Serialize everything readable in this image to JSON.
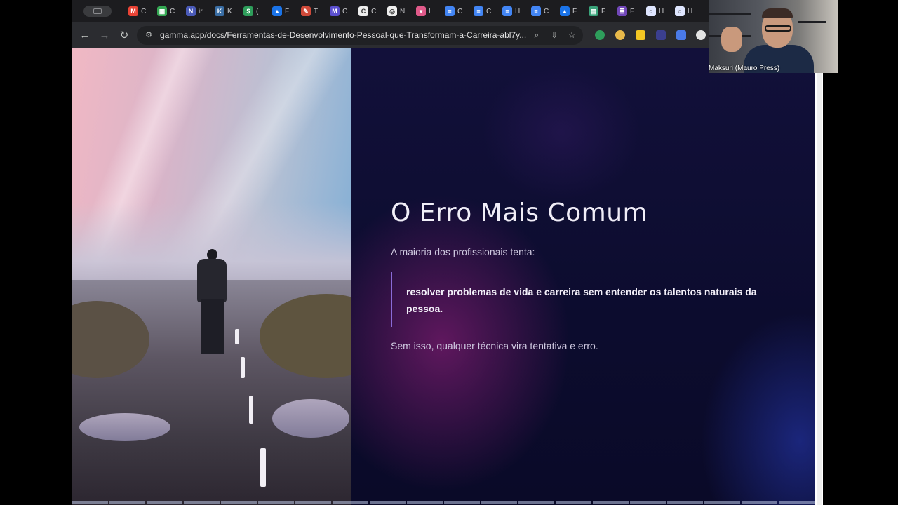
{
  "browser": {
    "tabs": [
      {
        "icon": "gmail-icon",
        "color": "#ea4335",
        "glyph": "M",
        "label": "C"
      },
      {
        "icon": "sheets-icon",
        "color": "#34a853",
        "glyph": "▦",
        "label": "C"
      },
      {
        "icon": "n8n-icon",
        "color": "#4a5ab8",
        "glyph": "N",
        "label": "ir"
      },
      {
        "icon": "k-icon",
        "color": "#3a6ea5",
        "glyph": "K",
        "label": "K"
      },
      {
        "icon": "dollar-icon",
        "color": "#2e9e5b",
        "glyph": "$",
        "label": "("
      },
      {
        "icon": "drive-icon",
        "color": "#1a73e8",
        "glyph": "▲",
        "label": "F"
      },
      {
        "icon": "app-icon",
        "color": "#d04a3a",
        "glyph": "✎",
        "label": "T"
      },
      {
        "icon": "m-icon",
        "color": "#5b4fcf",
        "glyph": "M",
        "label": "C"
      },
      {
        "icon": "c-icon",
        "color": "#eeeeee",
        "glyph": "C",
        "label": "C"
      },
      {
        "icon": "openai-icon",
        "color": "#eeeeee",
        "glyph": "◎",
        "label": "N"
      },
      {
        "icon": "heart-icon",
        "color": "#e05a8a",
        "glyph": "♥",
        "label": "L"
      },
      {
        "icon": "docs-icon",
        "color": "#4285f4",
        "glyph": "≡",
        "label": "C"
      },
      {
        "icon": "docs-icon",
        "color": "#4285f4",
        "glyph": "≡",
        "label": "C"
      },
      {
        "icon": "docs-icon",
        "color": "#4285f4",
        "glyph": "≡",
        "label": "H"
      },
      {
        "icon": "docs-icon",
        "color": "#4285f4",
        "glyph": "≡",
        "label": "C"
      },
      {
        "icon": "drive-icon",
        "color": "#1a73e8",
        "glyph": "▲",
        "label": "F"
      },
      {
        "icon": "calendar-icon",
        "color": "#3aa37a",
        "glyph": "▤",
        "label": "F"
      },
      {
        "icon": "forms-icon",
        "color": "#7248b9",
        "glyph": "≣",
        "label": "F"
      },
      {
        "icon": "globe-icon",
        "color": "#dfe6ff",
        "glyph": "○",
        "label": "H"
      },
      {
        "icon": "globe-icon",
        "color": "#dfe6ff",
        "glyph": "○",
        "label": "H"
      }
    ],
    "url": "gamma.app/docs/Ferramentas-de-Desenvolvimento-Pessoal-que-Transformam-a-Carreira-abl7y..."
  },
  "slide": {
    "title": "O Erro Mais Comum",
    "intro": "A maioria dos profissionais tenta:",
    "quote": "resolver problemas de vida e carreira sem entender os talentos naturais da pessoa.",
    "outro": "Sem isso, qualquer técnica vira tentativa e erro."
  },
  "video_call": {
    "participant_name": "Maksuri (Mauro Press)"
  },
  "colors": {
    "slide_bg": "#0c0c2e",
    "quote_bar": "#8a6bd6",
    "title": "#f1eef8"
  }
}
